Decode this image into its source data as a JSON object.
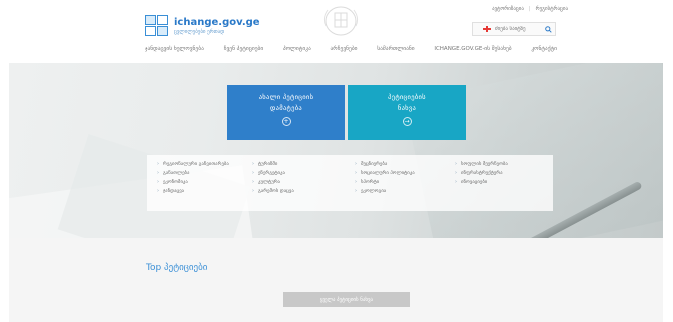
{
  "header": {
    "logo_title": "ichange.gov.ge",
    "logo_subtitle": "ცვლილებები ერთად",
    "top_links": [
      "ავტორიზაცია",
      "რეგისტრაცია"
    ],
    "search_placeholder": "ძიება საიტზე",
    "nav": [
      "ჯანდაცვის ხელოვნება",
      "ჩვენ პეტიციები",
      "პოლიტიკა",
      "არჩევნები",
      "სამართლიანი",
      "ICHANGE.GOV.GE-ის შესახებ",
      "კონტაქტი"
    ]
  },
  "hero": {
    "tiles": [
      {
        "line1": "ახალი პეტიციის",
        "line2": "დამატება",
        "icon": "+"
      },
      {
        "line1": "პეტიციების",
        "line2": "ნახვა",
        "icon": "→"
      }
    ],
    "categories": [
      "რეგიონალური განვითარება",
      "განათლება",
      "ეკონომიკა",
      "ჯანდაცვა",
      "ტურიზმი",
      "ენერგეტიკა",
      "კულტურა",
      "გარემოს დაცვა",
      "მეცნიერება",
      "სოციალური პოლიტიკა",
      "სპორტი",
      "ეკოლოგია",
      "სოფლის მეურნეობა",
      "ინფრასტრუქტურა",
      "ინოვაციები"
    ]
  },
  "main": {
    "top_title": "Top პეტიციები",
    "all_button": "ყველა პეტიციის ნახვა"
  },
  "colors": {
    "tile_blue": "#2f7fca",
    "tile_teal": "#18a6c5",
    "link_blue": "#3a8fd6"
  }
}
